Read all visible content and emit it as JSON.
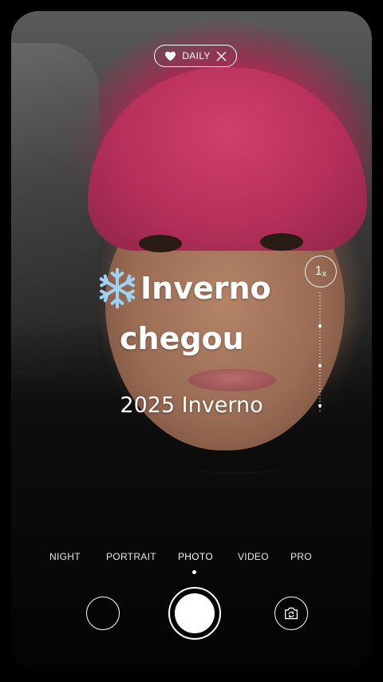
{
  "top_pill": {
    "label": "DAILY",
    "icon_heart": "heart-icon",
    "icon_close": "close-icon"
  },
  "zoom": {
    "value": "1",
    "suffix": "x"
  },
  "sticker": {
    "emoji": "snowflake-icon",
    "line1": "Inverno",
    "line2": "chegou"
  },
  "subtitle": "2025 Inverno",
  "modes": [
    {
      "label": "NIGHT"
    },
    {
      "label": "PORTRAIT"
    },
    {
      "label": "PHOTO",
      "active": true
    },
    {
      "label": "VIDEO"
    },
    {
      "label": "PRO"
    }
  ],
  "colors": {
    "accent": "#ffffff",
    "beanie": "#c0355e",
    "snowflake": "#9fd3f5"
  }
}
